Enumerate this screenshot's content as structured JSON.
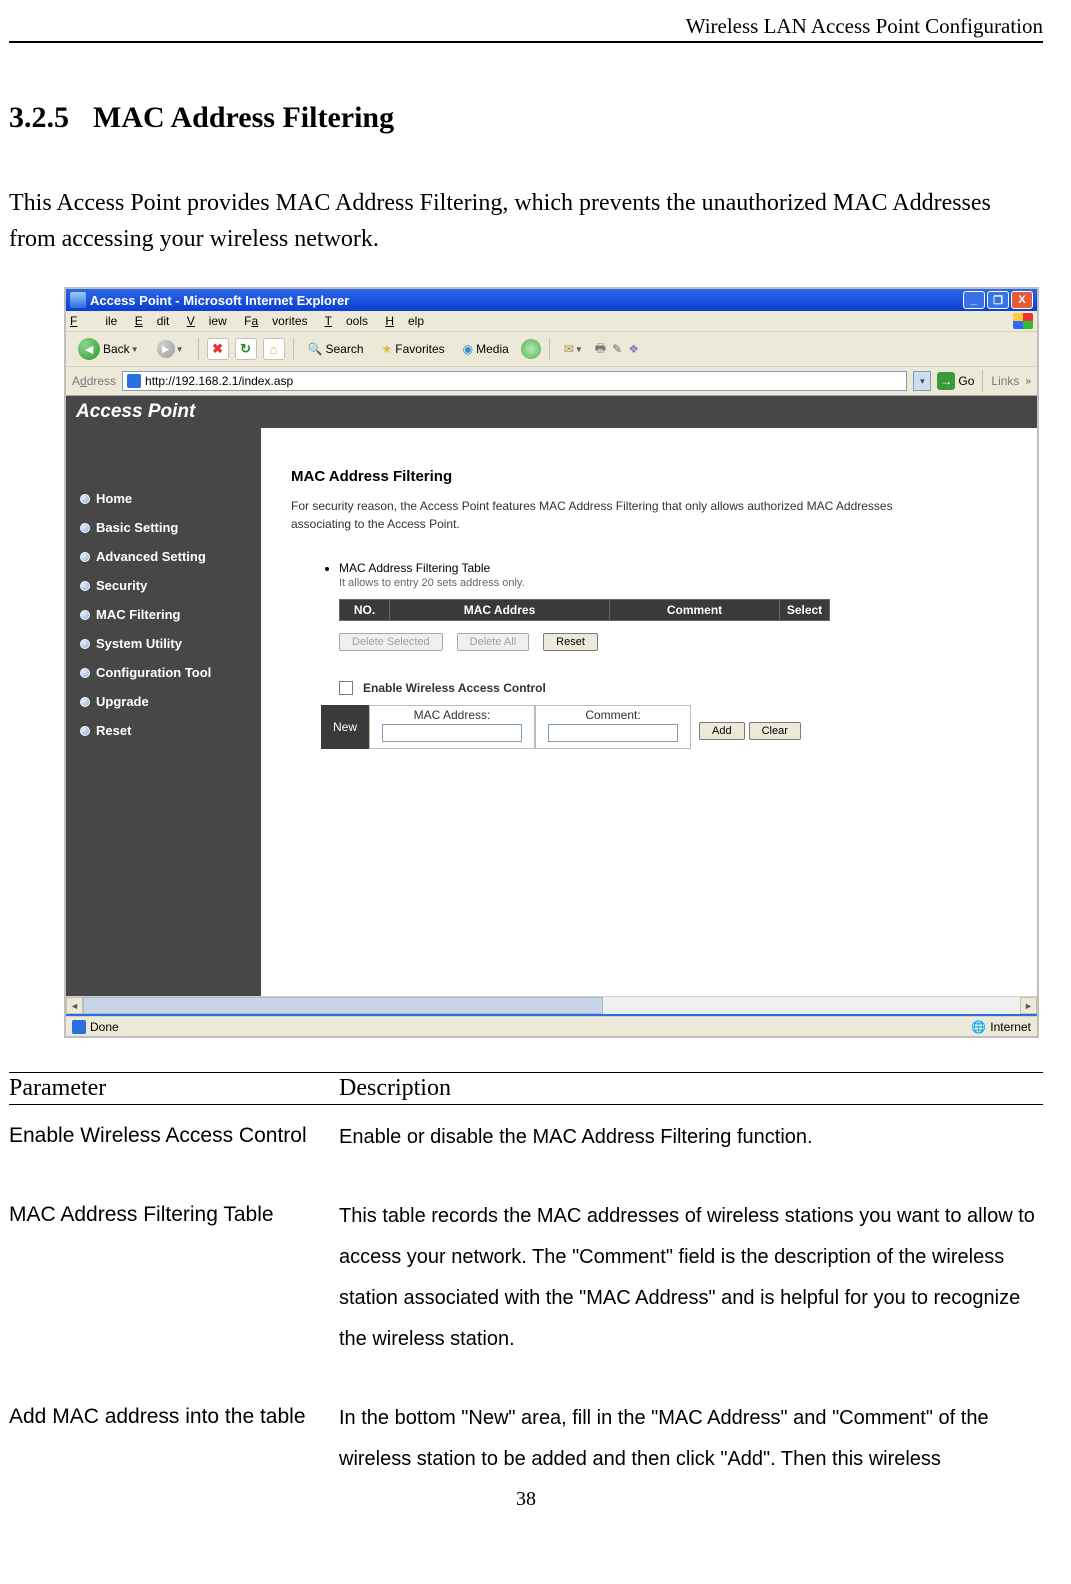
{
  "doc": {
    "header": "Wireless LAN Access Point Configuration",
    "section_number": "3.2.5",
    "section_title": "MAC Address Filtering",
    "intro": "This Access Point provides MAC Address Filtering, which prevents the unauthorized MAC Addresses from accessing your wireless network.",
    "page_number": "38"
  },
  "browser": {
    "title": "Access Point - Microsoft Internet Explorer",
    "win": {
      "min": "_",
      "max": "❐",
      "close": "X"
    },
    "menu": {
      "file": "File",
      "edit": "Edit",
      "view": "View",
      "favorites": "Favorites",
      "tools": "Tools",
      "help": "Help"
    },
    "toolbar": {
      "back": "Back",
      "search": "Search",
      "favorites": "Favorites",
      "media": "Media"
    },
    "address": {
      "label": "Address",
      "value": "http://192.168.2.1/index.asp",
      "go": "Go",
      "links": "Links"
    },
    "banner": "Access Point",
    "sidebar": [
      "Home",
      "Basic Setting",
      "Advanced Setting",
      "Security",
      "MAC Filtering",
      "System Utility",
      "Configuration Tool",
      "Upgrade",
      "Reset"
    ],
    "main": {
      "title": "MAC Address Filtering",
      "desc": "For security reason, the Access Point features MAC Address Filtering that only allows authorized MAC Addresses associating to the Access Point.",
      "sub_bullet": "MAC Address Filtering Table",
      "sub_hint": "It allows to entry 20 sets address only.",
      "th": {
        "no": "NO.",
        "mac": "MAC Addres",
        "com": "Comment",
        "sel": "Select"
      },
      "btn": {
        "delsel": "Delete Selected",
        "delall": "Delete All",
        "reset": "Reset"
      },
      "enable": "Enable Wireless Access Control",
      "newlbl": "New",
      "grp": {
        "mac": "MAC Address:",
        "com": "Comment:"
      },
      "addbtn": "Add",
      "clearbtn": "Clear"
    },
    "status": {
      "done": "Done",
      "zone": "Internet"
    }
  },
  "params": {
    "head_left": "Parameter",
    "head_right": "Description",
    "rows": [
      {
        "p": "Enable Wireless Access Control",
        "d": "Enable or disable the MAC Address Filtering function."
      },
      {
        "p": "MAC Address Filtering Table",
        "d": "This table records the MAC addresses of wireless stations you want to allow to access your network. The \"Comment\" field is the description of the wireless station associated with the \"MAC Address\" and is helpful for you to recognize the wireless station."
      },
      {
        "p": "Add MAC address into the table",
        "d": "In the bottom \"New\" area, fill in the \"MAC Address\" and \"Comment\" of the wireless station to be added and then click \"Add\". Then this wireless"
      }
    ]
  }
}
